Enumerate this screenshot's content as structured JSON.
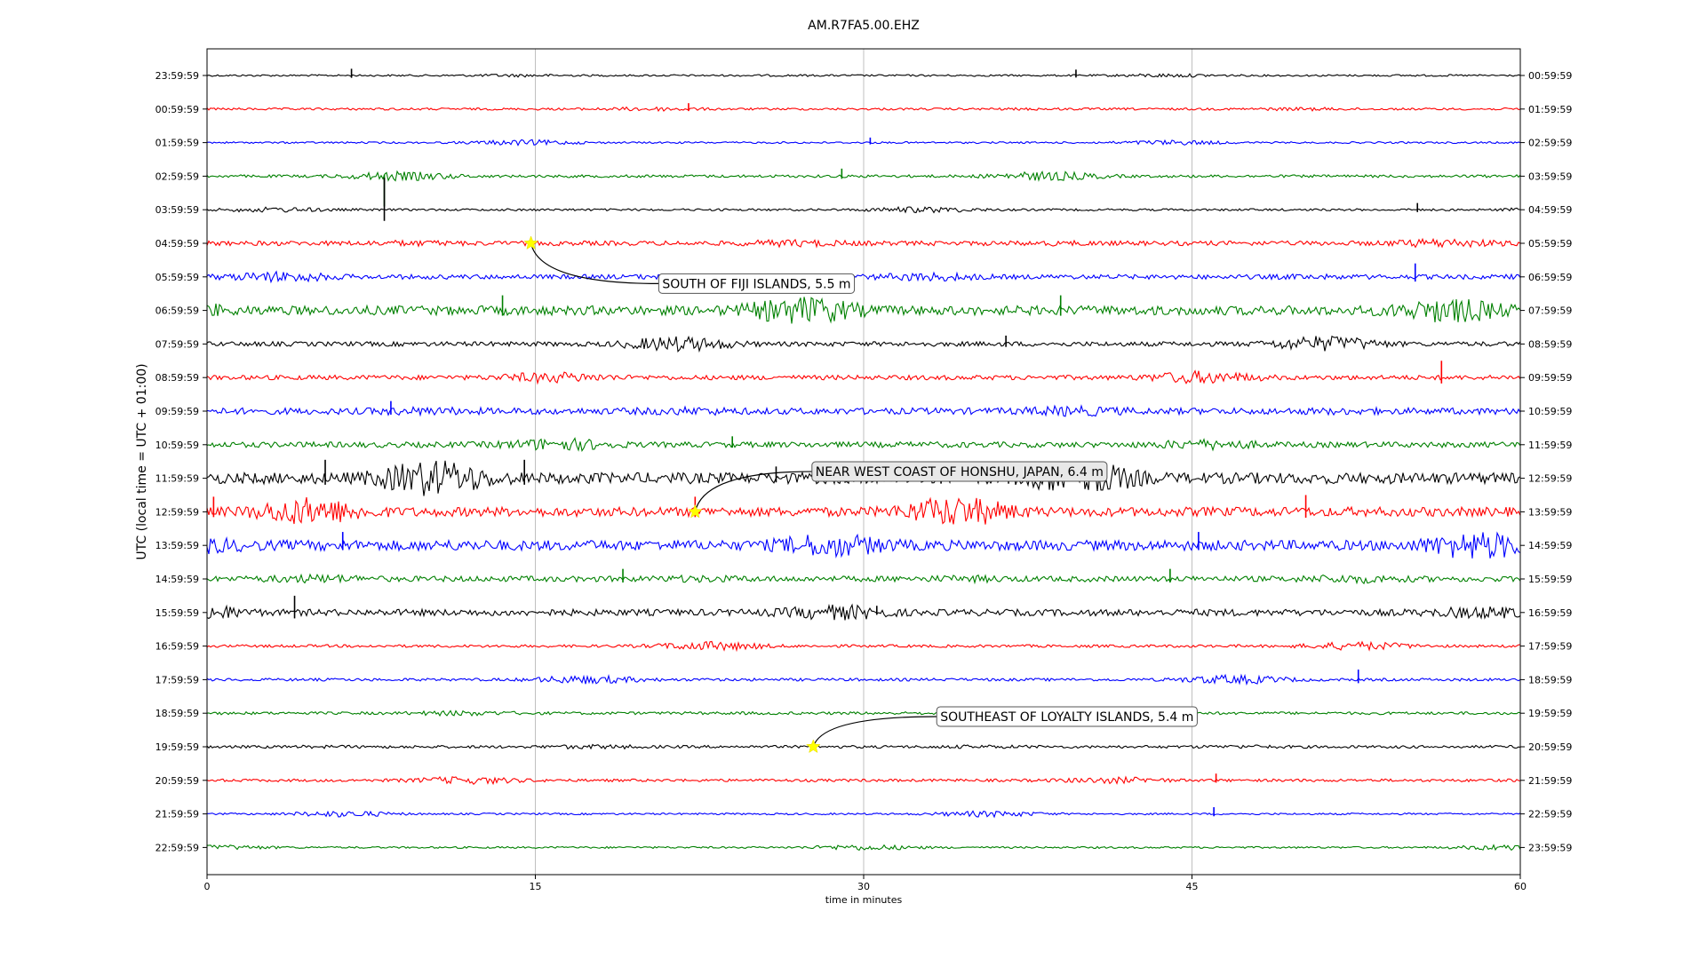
{
  "chart_data": {
    "type": "line",
    "title": "AM.R7FA5.00.EHZ",
    "xlabel": "time in minutes",
    "ylabel": "UTC (local time = UTC + 01:00)",
    "xlim": [
      0,
      60
    ],
    "x_ticks": [
      0,
      15,
      30,
      45,
      60
    ],
    "grid": "vertical lines at x ticks",
    "colors": [
      "#000000",
      "#ff0000",
      "#0000ff",
      "#008000"
    ],
    "left_labels": [
      "23:59:59",
      "00:59:59",
      "01:59:59",
      "02:59:59",
      "03:59:59",
      "04:59:59",
      "05:59:59",
      "06:59:59",
      "07:59:59",
      "08:59:59",
      "09:59:59",
      "10:59:59",
      "11:59:59",
      "12:59:59",
      "13:59:59",
      "14:59:59",
      "15:59:59",
      "16:59:59",
      "17:59:59",
      "18:59:59",
      "19:59:59",
      "20:59:59",
      "21:59:59",
      "22:59:59"
    ],
    "right_labels": [
      "00:59:59",
      "01:59:59",
      "02:59:59",
      "03:59:59",
      "04:59:59",
      "05:59:59",
      "06:59:59",
      "07:59:59",
      "08:59:59",
      "09:59:59",
      "10:59:59",
      "11:59:59",
      "12:59:59",
      "13:59:59",
      "14:59:59",
      "15:59:59",
      "16:59:59",
      "17:59:59",
      "18:59:59",
      "19:59:59",
      "20:59:59",
      "21:59:59",
      "22:59:59",
      "23:59:59"
    ],
    "trace_noise_level": [
      0.1,
      0.12,
      0.1,
      0.15,
      0.12,
      0.25,
      0.25,
      0.5,
      0.25,
      0.25,
      0.35,
      0.3,
      0.6,
      0.5,
      0.55,
      0.3,
      0.35,
      0.15,
      0.15,
      0.15,
      0.15,
      0.15,
      0.1,
      0.1
    ],
    "spikes": [
      {
        "row": 0,
        "x": 6.6,
        "amp": 0.4
      },
      {
        "row": 0,
        "x": 39.7,
        "amp": 0.35
      },
      {
        "row": 1,
        "x": 22.0,
        "amp": 0.35
      },
      {
        "row": 2,
        "x": 30.3,
        "amp": 0.3
      },
      {
        "row": 3,
        "x": 8.1,
        "amp": 1.8,
        "dir": -1
      },
      {
        "row": 3,
        "x": 29.0,
        "amp": 0.45
      },
      {
        "row": 4,
        "x": 8.1,
        "amp": 1.9
      },
      {
        "row": 4,
        "x": 55.3,
        "amp": 0.4
      },
      {
        "row": 6,
        "x": 55.2,
        "amp": 0.8
      },
      {
        "row": 7,
        "x": 13.5,
        "amp": 0.9
      },
      {
        "row": 7,
        "x": 39.0,
        "amp": 0.9
      },
      {
        "row": 8,
        "x": 36.5,
        "amp": 0.5
      },
      {
        "row": 9,
        "x": 56.4,
        "amp": 1.0
      },
      {
        "row": 10,
        "x": 8.4,
        "amp": 0.6
      },
      {
        "row": 11,
        "x": 24.0,
        "amp": 0.5
      },
      {
        "row": 12,
        "x": 5.4,
        "amp": 1.1
      },
      {
        "row": 12,
        "x": 14.5,
        "amp": 1.1
      },
      {
        "row": 12,
        "x": 26.0,
        "amp": 0.7
      },
      {
        "row": 13,
        "x": 0.3,
        "amp": 0.9
      },
      {
        "row": 13,
        "x": 22.3,
        "amp": 0.9
      },
      {
        "row": 13,
        "x": 50.2,
        "amp": 1.0
      },
      {
        "row": 14,
        "x": 6.2,
        "amp": 0.8
      },
      {
        "row": 14,
        "x": 45.3,
        "amp": 0.8
      },
      {
        "row": 15,
        "x": 19.0,
        "amp": 0.6
      },
      {
        "row": 15,
        "x": 44.0,
        "amp": 0.6
      },
      {
        "row": 16,
        "x": 4.0,
        "amp": 1.0
      },
      {
        "row": 16,
        "x": 30.6,
        "amp": 0.4
      },
      {
        "row": 18,
        "x": 52.6,
        "amp": 0.6
      },
      {
        "row": 21,
        "x": 46.1,
        "amp": 0.4
      },
      {
        "row": 22,
        "x": 46.0,
        "amp": 0.4
      }
    ],
    "events": [
      {
        "label": "SOUTH OF FIJI ISLANDS, 5.5 m",
        "row": 5,
        "x": 14.8,
        "label_x": 20.8,
        "label_row": 6.2,
        "box_fill": "#ffffff",
        "text_anchor": "start"
      },
      {
        "label": "NEAR WEST COAST OF HONSHU, JAPAN, 6.4 m",
        "row": 13,
        "x": 22.3,
        "label_x": 27.8,
        "label_row": 11.8,
        "box_fill": "#e8e8e8",
        "text_anchor": "start"
      },
      {
        "label": "SOUTHEAST OF LOYALTY ISLANDS, 5.4 m",
        "row": 20,
        "x": 27.7,
        "label_x": 33.5,
        "label_row": 19.1,
        "box_fill": "#ffffff",
        "text_anchor": "start"
      }
    ]
  }
}
